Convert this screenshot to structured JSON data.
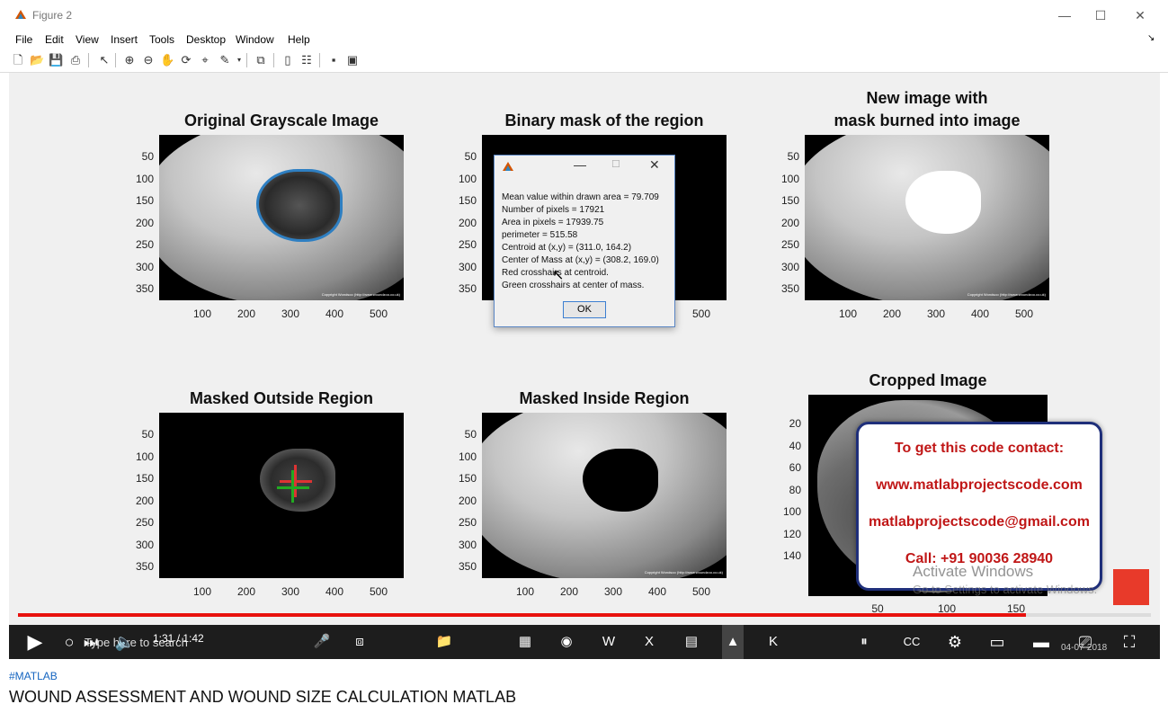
{
  "window": {
    "title": "Figure 2",
    "controls": [
      "—",
      "☐",
      "✕"
    ]
  },
  "menubar": {
    "items": [
      "File",
      "Edit",
      "View",
      "Insert",
      "Tools",
      "Desktop",
      "Window",
      "Help"
    ]
  },
  "plots": {
    "p1": {
      "title": "Original Grayscale Image"
    },
    "p2": {
      "title": "Binary mask of the region"
    },
    "p3": {
      "title_line1": "New image with",
      "title_line2": "mask burned into image"
    },
    "p4": {
      "title": "Masked Outside Region"
    },
    "p5": {
      "title": "Masked Inside Region"
    },
    "p6": {
      "title": "Cropped Image"
    }
  },
  "axes": {
    "y_ticks": [
      "50",
      "100",
      "150",
      "200",
      "250",
      "300",
      "350"
    ],
    "x_ticks": [
      "100",
      "200",
      "300",
      "400",
      "500"
    ],
    "crop_y_ticks": [
      "20",
      "40",
      "60",
      "80",
      "100",
      "120",
      "140"
    ],
    "crop_x_ticks": [
      "50",
      "100",
      "150"
    ]
  },
  "copyright_text": "Copyright Wondsoo (http://www.woundzoo.co.uk)",
  "dialog": {
    "lines": [
      "Mean value within drawn area = 79.709",
      "Number of pixels = 17921",
      "Area in pixels = 17939.75",
      "perimeter = 515.58",
      "Centroid at (x,y) = (311.0, 164.2)",
      "Center of Mass at (x,y) = (308.2, 169.0)",
      "Red crosshairs at centroid.",
      "Green crosshairs at center of mass."
    ],
    "ok_label": "OK"
  },
  "promo": {
    "line1": "To get this code contact:",
    "line2": "www.matlabprojectscode.com",
    "line3": "matlabprojectscode@gmail.com",
    "line4": "Call: +91 90036 28940"
  },
  "activation": {
    "line1": "Activate Windows",
    "line2": "Go to Settings to activate Windows."
  },
  "player": {
    "time": "1:31 / 1:42",
    "progress": 0.89,
    "search_placeholder": "Type here to search",
    "date": "04-07-2018",
    "accent": "#e8120e"
  },
  "video": {
    "hashtag": "#MATLAB",
    "title": "WOUND ASSESSMENT AND WOUND SIZE CALCULATION MATLAB"
  }
}
